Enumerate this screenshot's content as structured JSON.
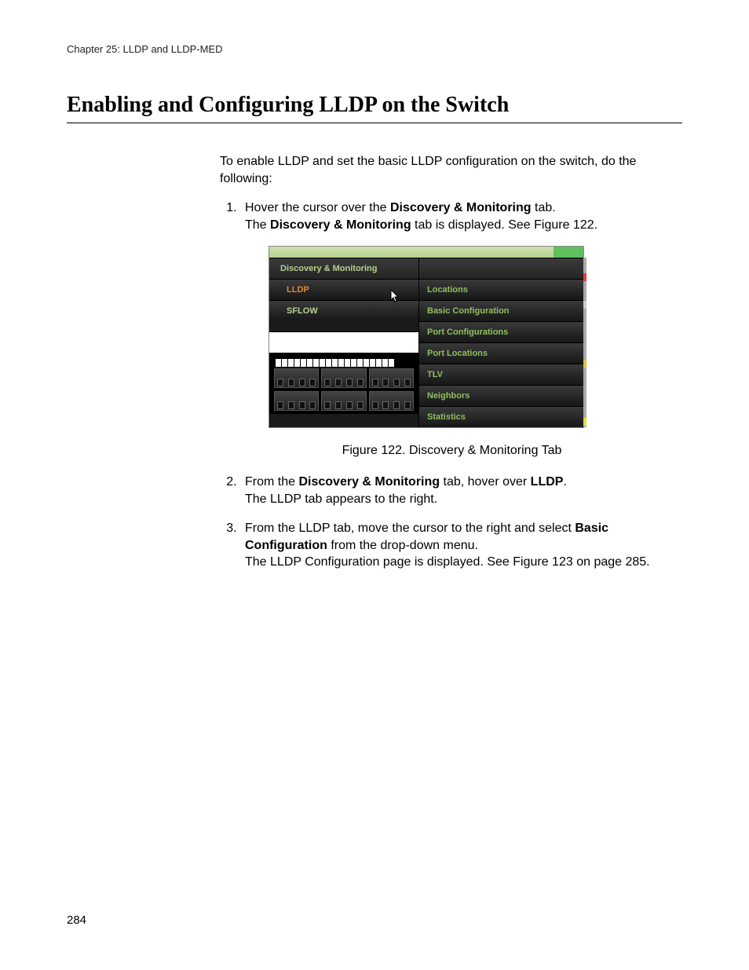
{
  "chapter_header": "Chapter 25: LLDP and LLDP-MED",
  "section_title": "Enabling and Configuring LLDP on the Switch",
  "intro": "To enable LLDP and set the basic LLDP configuration on the switch, do the following:",
  "steps": {
    "s1_a": "Hover the cursor over the ",
    "s1_b": "Discovery & Monitoring",
    "s1_c": " tab.",
    "s1_sub_a": "The ",
    "s1_sub_b": "Discovery & Monitoring",
    "s1_sub_c": " tab is displayed. See Figure 122.",
    "s2_a": "From the ",
    "s2_b": "Discovery & Monitoring",
    "s2_c": " tab, hover over ",
    "s2_d": "LLDP",
    "s2_e": ".",
    "s2_sub": "The LLDP tab appears to the right.",
    "s3_a": "From the LLDP tab, move the cursor to the right and select ",
    "s3_b": "Basic Configuration",
    "s3_c": " from the drop-down menu.",
    "s3_sub": "The LLDP Configuration page is displayed. See Figure 123 on page 285."
  },
  "figure_caption": "Figure 122. Discovery & Monitoring Tab",
  "figure": {
    "left_header": "Discovery & Monitoring",
    "left_items": [
      "LLDP",
      "SFLOW"
    ],
    "right_items": [
      "Locations",
      "Basic Configuration",
      "Port Configurations",
      "Port Locations",
      "TLV",
      "Neighbors",
      "Statistics"
    ]
  },
  "page_number": "284"
}
